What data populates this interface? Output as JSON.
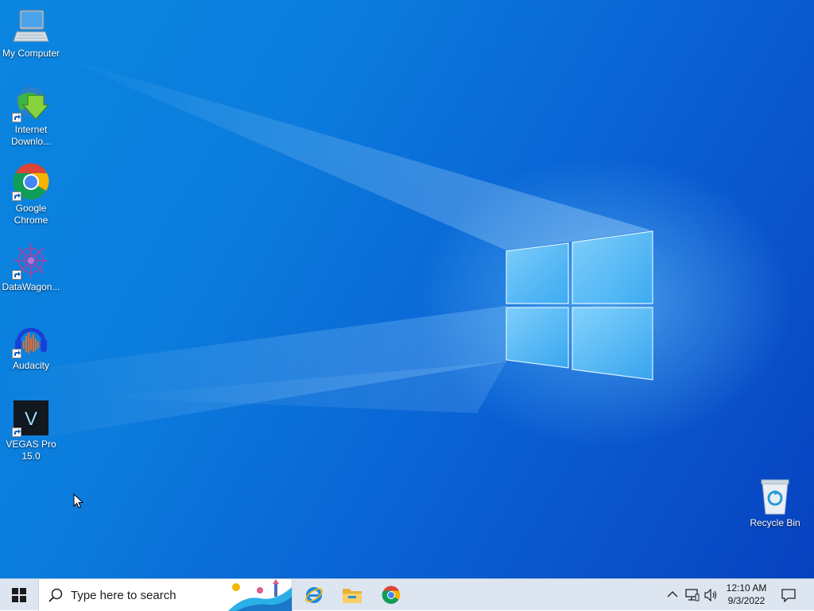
{
  "desktop": {
    "icons": [
      {
        "label": "My Computer",
        "icon": "computer-icon"
      },
      {
        "label": "Internet Downlo...",
        "icon": "internet-download-manager-icon"
      },
      {
        "label": "Google Chrome",
        "icon": "chrome-icon"
      },
      {
        "label": "DataWagon...",
        "icon": "datawagon-icon"
      },
      {
        "label": "Audacity",
        "icon": "audacity-icon"
      },
      {
        "label": "VEGAS Pro 15.0",
        "icon": "vegas-pro-icon"
      },
      {
        "label": "Recycle Bin",
        "icon": "recycle-bin-icon"
      }
    ]
  },
  "taskbar": {
    "search_placeholder": "Type here to search",
    "pinned": [
      "internet-explorer-icon",
      "file-explorer-icon",
      "chrome-icon"
    ],
    "tray": {
      "icons": [
        "chevron-up-icon",
        "network-icon",
        "volume-icon"
      ],
      "time": "12:10 AM",
      "date": "9/3/2022"
    }
  },
  "colors": {
    "desktop_blue": "#0b7ddd",
    "taskbar_bg": "#dde6f0",
    "chrome_red": "#db4437",
    "chrome_yellow": "#f4b400",
    "chrome_green": "#0f9d58",
    "chrome_blue": "#4285f4"
  }
}
